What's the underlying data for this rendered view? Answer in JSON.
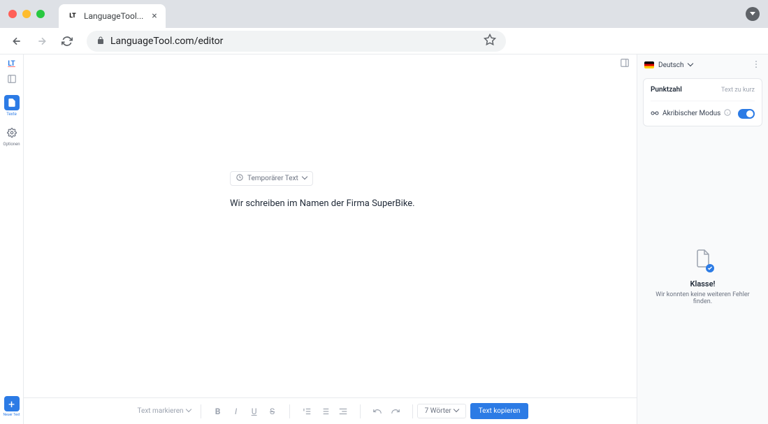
{
  "browser": {
    "tab_title": "LanguageTool...",
    "url": "LanguageTool.com/editor"
  },
  "sidebar": {
    "texts_label": "Texte",
    "options_label": "Optionen",
    "new_text_label": "Neuer Text"
  },
  "editor": {
    "temp_badge": "Temporärer Text",
    "content": "Wir schreiben im Namen der Firma SuperBike."
  },
  "toolbar": {
    "highlight_label": "Text markieren",
    "word_count": "7 Wörter",
    "copy_label": "Text kopieren"
  },
  "panel": {
    "language": "Deutsch",
    "score_label": "Punktzahl",
    "score_status": "Text zu kurz",
    "mode_label": "Akribischer Modus",
    "empty_title": "Klasse!",
    "empty_sub": "Wir konnten keine weiteren Fehler finden."
  }
}
